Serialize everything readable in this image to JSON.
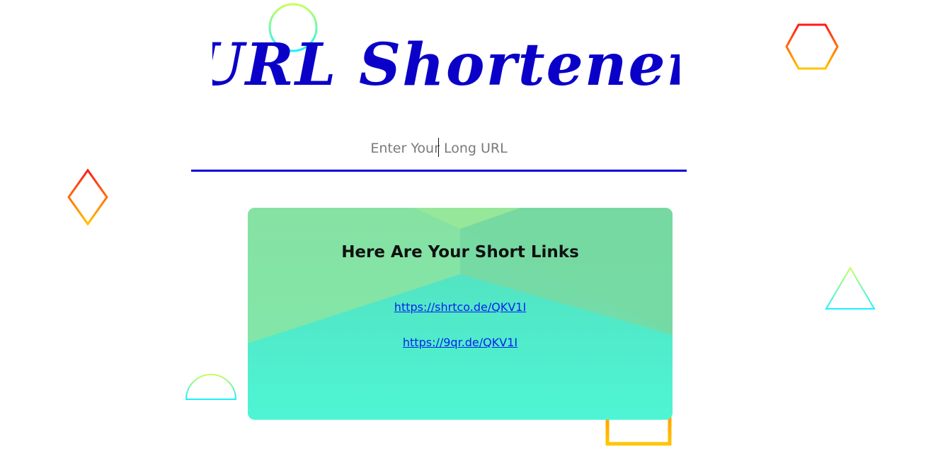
{
  "header": {
    "title": "URL Shortener",
    "title_color": "#0a00c8"
  },
  "url_input": {
    "value": "",
    "placeholder": "Enter Your Long URL",
    "underline_color": "#0a00d8"
  },
  "results": {
    "heading": "Here Are Your Short Links",
    "links": [
      {
        "text": "https://shrtco.de/QKV1I"
      },
      {
        "text": "https://9qr.de/QKV1I"
      }
    ]
  },
  "decorations": {
    "colors": {
      "warm_start": "#ff1a1a",
      "warm_end": "#ffc400",
      "cool_start": "#c8ff5a",
      "cool_end": "#1cf0ff"
    },
    "shapes": [
      "circle-icon",
      "hexagon-icon",
      "diamond-icon",
      "triangle-icon",
      "semicircle-icon",
      "square-icon"
    ]
  }
}
